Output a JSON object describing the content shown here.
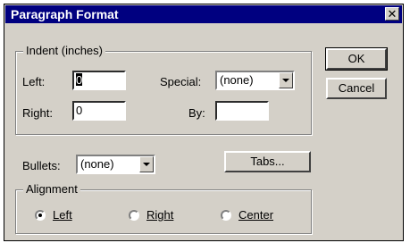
{
  "dialog": {
    "title": "Paragraph Format",
    "close_icon": "close-icon"
  },
  "indent": {
    "legend": "Indent (inches)",
    "left_label": "Left:",
    "left_value": "0",
    "right_label": "Right:",
    "right_value": "0",
    "special_label": "Special:",
    "special_value": "(none)",
    "by_label": "By:",
    "by_value": ""
  },
  "bullets": {
    "label": "Bullets:",
    "value": "(none)"
  },
  "alignment": {
    "legend": "Alignment",
    "options": [
      {
        "label": "Left",
        "selected": true
      },
      {
        "label": "Right",
        "selected": false
      },
      {
        "label": "Center",
        "selected": false
      }
    ]
  },
  "buttons": {
    "ok": "OK",
    "cancel": "Cancel",
    "tabs": "Tabs..."
  },
  "colors": {
    "titlebar": "#000080",
    "face": "#d4d0c8"
  }
}
